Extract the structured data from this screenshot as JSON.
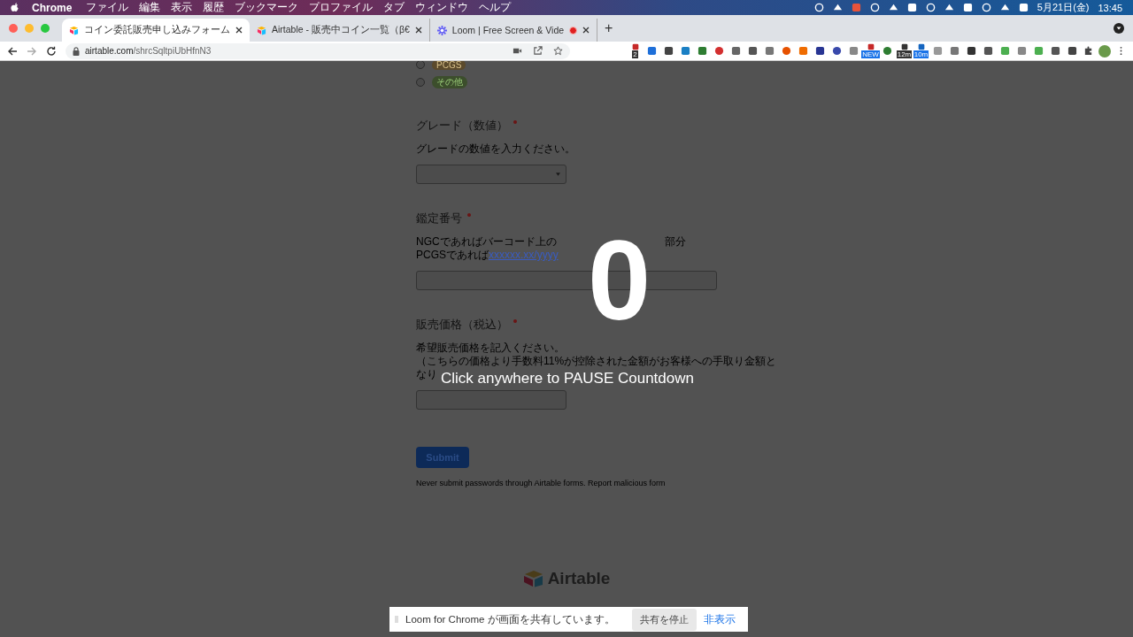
{
  "menu_bar": {
    "app": "Chrome",
    "items": [
      "ファイル",
      "編集",
      "表示",
      "履歴",
      "ブックマーク",
      "プロファイル",
      "タブ",
      "ウィンドウ",
      "ヘルプ"
    ],
    "date": "5月21日(金)",
    "time": "13:45"
  },
  "tabs": [
    {
      "title": "コイン委託販売申し込みフォーム",
      "selected": true,
      "kind": "airtable"
    },
    {
      "title": "Airtable - 販売中コイン一覧（β€",
      "selected": false,
      "kind": "airtable"
    },
    {
      "title": "Loom | Free Screen & Vide",
      "selected": false,
      "kind": "loom"
    }
  ],
  "new_tab": "+",
  "address_bar": {
    "url_host": "airtable.com",
    "url_path": "/shrcSqltpiUbHfnN3"
  },
  "extension_badges": [
    "2",
    "NEW",
    "12m",
    "10m"
  ],
  "form": {
    "options": [
      {
        "label": "PCGS",
        "color": "#5b4a2c",
        "selected": false
      },
      {
        "label": "その他",
        "color": "#3c4e2c",
        "selected": false
      }
    ],
    "fields": [
      {
        "kind": "select",
        "title": "グレード（数値）",
        "required": true,
        "description": [
          "グレードの数値を入力ください。"
        ]
      },
      {
        "kind": "code",
        "title": "鑑定番号",
        "required": true,
        "line1": "NGCであればバーコード上の",
        "line1_tail": "部分",
        "line2": "PCGSであれば",
        "link": "xxxxxx.xx/yyyy"
      },
      {
        "kind": "text",
        "title": "販売価格（税込）",
        "required": true,
        "description": [
          "希望販売価格を記入ください。",
          "（こちらの価格より手数料11%が控除された金額がお客様への手取り金額と",
          "なり"
        ]
      }
    ],
    "submit": "Submit",
    "footer": "Never submit passwords through Airtable forms. Report malicious form"
  },
  "brand": "Airtable",
  "countdown": {
    "number": "0",
    "hint": "Click anywhere to PAUSE Countdown"
  },
  "share_bar": {
    "message": "Loom for Chrome が画面を共有しています。",
    "stop": "共有を停止",
    "hide": "非表示"
  }
}
